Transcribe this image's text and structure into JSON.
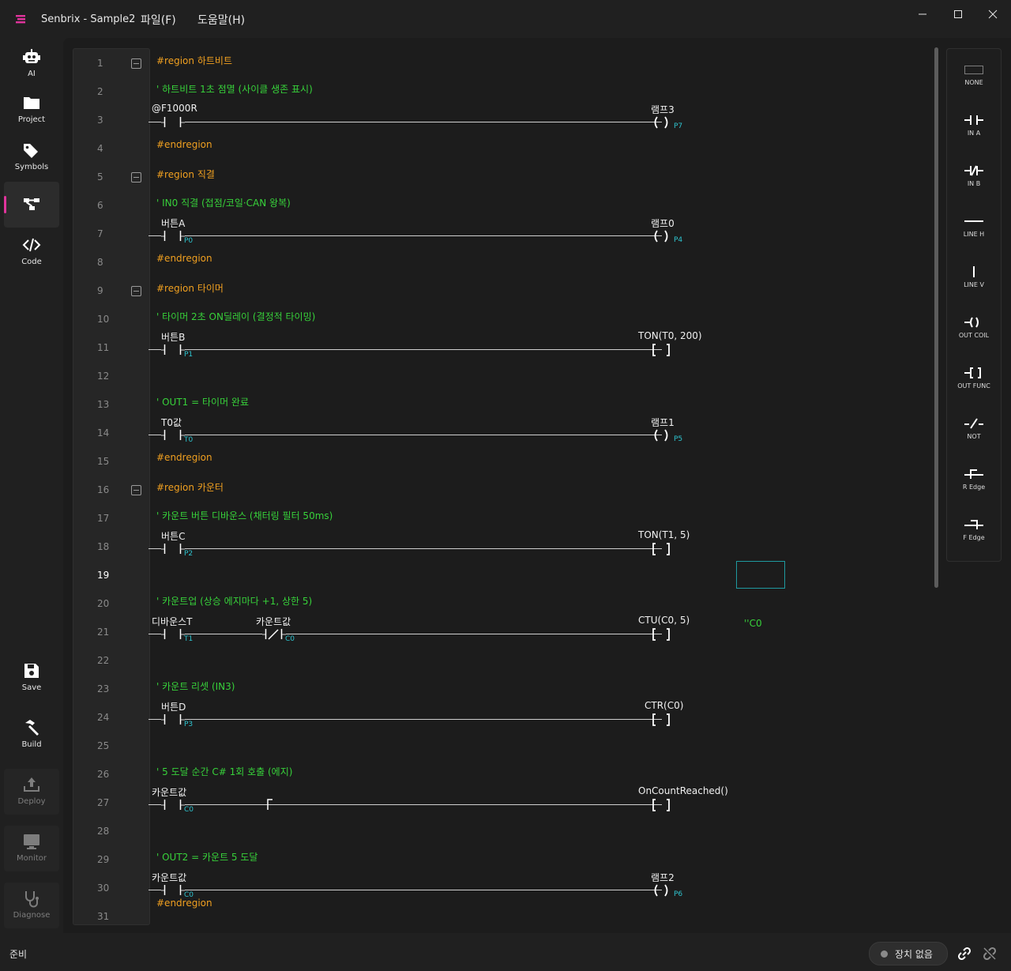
{
  "app": {
    "title": "Senbrix - Sample2"
  },
  "menu": {
    "file": "파일(F)",
    "help": "도움말(H)"
  },
  "colors": {
    "accent": "#e0349c",
    "region": "#f0a020",
    "comment": "#37d13a",
    "address": "#2ec4cf"
  },
  "sidebar": {
    "items": [
      {
        "name": "ai",
        "label": "AI",
        "icon": "robot-icon"
      },
      {
        "name": "project",
        "label": "Project",
        "icon": "folder-icon"
      },
      {
        "name": "symbols",
        "label": "Symbols",
        "icon": "tags-icon"
      },
      {
        "name": "ladder",
        "label": "",
        "icon": "ladder-diagram-icon",
        "active": true
      },
      {
        "name": "code",
        "label": "Code",
        "icon": "code-icon"
      },
      {
        "name": "save",
        "label": "Save",
        "icon": "save-icon"
      },
      {
        "name": "build",
        "label": "Build",
        "icon": "hammer-icon"
      },
      {
        "name": "deploy",
        "label": "Deploy",
        "icon": "upload-icon",
        "disabled": true
      },
      {
        "name": "monitor",
        "label": "Monitor",
        "icon": "monitor-icon",
        "disabled": true
      },
      {
        "name": "diagnose",
        "label": "Diagnose",
        "icon": "stethoscope-icon",
        "disabled": true
      }
    ]
  },
  "editor": {
    "current_line": 19,
    "line_numbers": [
      "1",
      "2",
      "3",
      "4",
      "5",
      "6",
      "7",
      "8",
      "9",
      "10",
      "11",
      "12",
      "13",
      "14",
      "15",
      "16",
      "17",
      "18",
      "19",
      "20",
      "21",
      "22",
      "23",
      "24",
      "25",
      "26",
      "27",
      "28",
      "29",
      "30",
      "31"
    ],
    "regions": [
      "#region 하트비트",
      "#endregion",
      "#region 직결",
      "#endregion",
      "#region 타이머",
      "#endregion",
      "#region 카운터",
      "#endregion"
    ],
    "comments": [
      "' 하트비트 1초 점멸 (사이클 생존 표시)",
      "' IN0 직결 (접점/코일·CAN 왕복)",
      "' 타이머 2초 ON딜레이 (결정적 타이밍)",
      "' OUT1 = 타이머 완료",
      "' 카운트 버튼 디바운스 (채터링 필터 50ms)",
      "' 카운트업 (상승 에지마다 +1, 상한 5)",
      "' 카운트 리셋 (IN3)",
      "' 5 도달 순간 C# 1회 호출 (에지)",
      "' OUT2 = 카운트 5 도달"
    ],
    "rungs": [
      {
        "contacts": [
          {
            "label": "@F1000R",
            "addr": ""
          }
        ],
        "output": {
          "label": "램프3",
          "addr": "P7",
          "kind": "coil"
        }
      },
      {
        "contacts": [
          {
            "label": "버튼A",
            "addr": "P0"
          }
        ],
        "output": {
          "label": "램프0",
          "addr": "P4",
          "kind": "coil"
        }
      },
      {
        "contacts": [
          {
            "label": "버튼B",
            "addr": "P1"
          }
        ],
        "output": {
          "label": "TON(T0, 200)",
          "addr": "",
          "kind": "func"
        }
      },
      {
        "contacts": [
          {
            "label": "T0값",
            "addr": "T0"
          }
        ],
        "output": {
          "label": "램프1",
          "addr": "P5",
          "kind": "coil"
        }
      },
      {
        "contacts": [
          {
            "label": "버튼C",
            "addr": "P2"
          }
        ],
        "output": {
          "label": "TON(T1, 5)",
          "addr": "",
          "kind": "func"
        }
      },
      {
        "contacts": [
          {
            "label": "디바운스T",
            "addr": "T1"
          },
          {
            "label": "카운트값",
            "addr": "C0"
          }
        ],
        "output": {
          "label": "CTU(C0, 5)",
          "addr": "",
          "kind": "func"
        },
        "side_comment": "''C0"
      },
      {
        "contacts": [
          {
            "label": "버튼D",
            "addr": "P3"
          }
        ],
        "output": {
          "label": "CTR(C0)",
          "addr": "",
          "kind": "func"
        }
      },
      {
        "contacts": [
          {
            "label": "카운트값",
            "addr": "C0"
          }
        ],
        "output": {
          "label": "OnCountReached()",
          "addr": "",
          "kind": "func"
        }
      },
      {
        "contacts": [
          {
            "label": "카운트값",
            "addr": "C0"
          }
        ],
        "output": {
          "label": "램프2",
          "addr": "P6",
          "kind": "coil"
        }
      }
    ]
  },
  "palette": {
    "items": [
      {
        "label": "NONE",
        "icon": "none-icon"
      },
      {
        "label": "IN A",
        "icon": "contact-a-icon"
      },
      {
        "label": "IN B",
        "icon": "contact-b-icon"
      },
      {
        "label": "LINE H",
        "icon": "line-h-icon"
      },
      {
        "label": "LINE V",
        "icon": "line-v-icon"
      },
      {
        "label": "OUT COIL",
        "icon": "coil-icon"
      },
      {
        "label": "OUT FUNC",
        "icon": "func-icon"
      },
      {
        "label": "NOT",
        "icon": "not-icon"
      },
      {
        "label": "R Edge",
        "icon": "rising-edge-icon"
      },
      {
        "label": "F Edge",
        "icon": "falling-edge-icon"
      }
    ]
  },
  "status": {
    "text": "준비",
    "device": "장치 없음"
  }
}
